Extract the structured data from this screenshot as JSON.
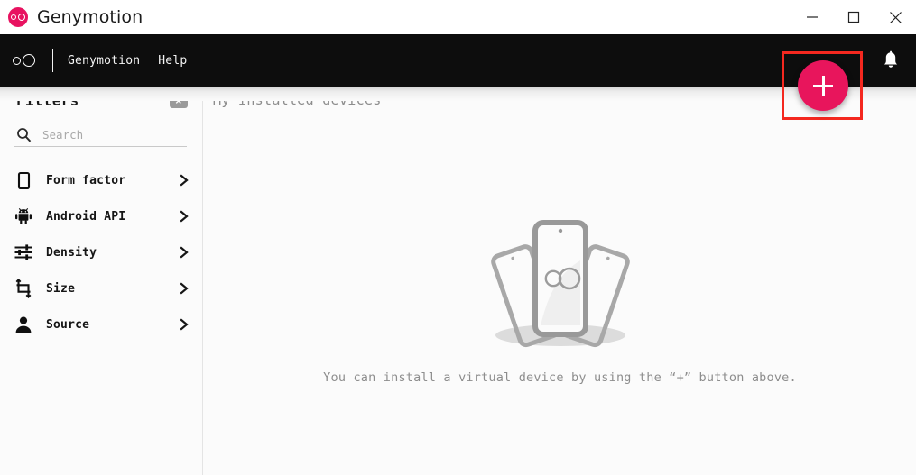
{
  "window": {
    "title": "Genymotion",
    "logo_icon": "genymotion-logo-icon",
    "controls": {
      "minimize": "minimize-icon",
      "maximize": "maximize-icon",
      "close": "close-icon"
    }
  },
  "toolbar": {
    "logo_icon": "genymotion-mark-icon",
    "menu": [
      {
        "label": "Genymotion"
      },
      {
        "label": "Help"
      }
    ],
    "notifications_icon": "bell-icon",
    "add_device_label": "+",
    "highlight_color": "#f4281f",
    "accent_color": "#e8155c"
  },
  "sidebar": {
    "title": "Filters",
    "clear_icon": "clear-filters-icon",
    "search": {
      "icon": "search-icon",
      "value": "",
      "placeholder": "Search"
    },
    "items": [
      {
        "label": "Form factor",
        "icon": "phone-icon"
      },
      {
        "label": "Android API",
        "icon": "android-icon"
      },
      {
        "label": "Density",
        "icon": "tune-sliders-icon"
      },
      {
        "label": "Size",
        "icon": "crop-resize-icon"
      },
      {
        "label": "Source",
        "icon": "person-icon"
      }
    ]
  },
  "main": {
    "title": "My installed devices",
    "empty_state": {
      "illustration": "three-phones-illustration",
      "caption": "You can install a virtual device by using the “+” button above."
    }
  }
}
